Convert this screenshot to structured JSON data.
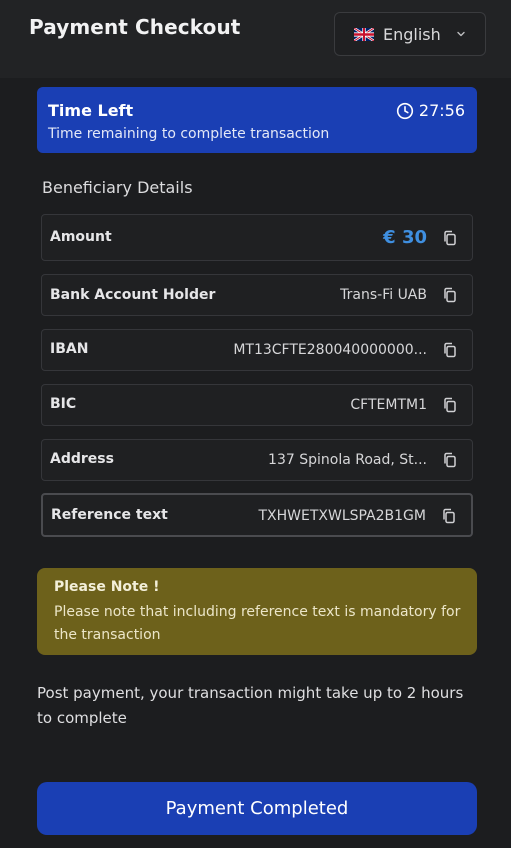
{
  "header": {
    "title": "Payment Checkout",
    "language": {
      "flag": "uk-flag-icon",
      "label": "English"
    }
  },
  "timer": {
    "title": "Time Left",
    "subtitle": "Time remaining to complete transaction",
    "remaining": "27:56"
  },
  "beneficiary": {
    "section_title": "Beneficiary Details",
    "rows": [
      {
        "label": "Amount",
        "value": "€ 30"
      },
      {
        "label": "Bank Account Holder",
        "value": "Trans-Fi UAB"
      },
      {
        "label": "IBAN",
        "value": "MT13CFTE280040000000..."
      },
      {
        "label": "BIC",
        "value": "CFTEMTM1"
      },
      {
        "label": "Address",
        "value": "137 Spinola Road, St..."
      },
      {
        "label": "Reference text",
        "value": "TXHWETXWLSPA2B1GM"
      }
    ]
  },
  "note": {
    "title": "Please Note !",
    "body": "Please note that including reference text is mandatory for the transaction"
  },
  "post_payment": "Post payment, your transaction might take up to 2 hours to complete",
  "cta": {
    "label": "Payment Completed"
  },
  "colors": {
    "primary": "#1a3fb4",
    "amount": "#3f8fe0",
    "note_bg": "#6d611b",
    "background": "#1c1d1f"
  }
}
